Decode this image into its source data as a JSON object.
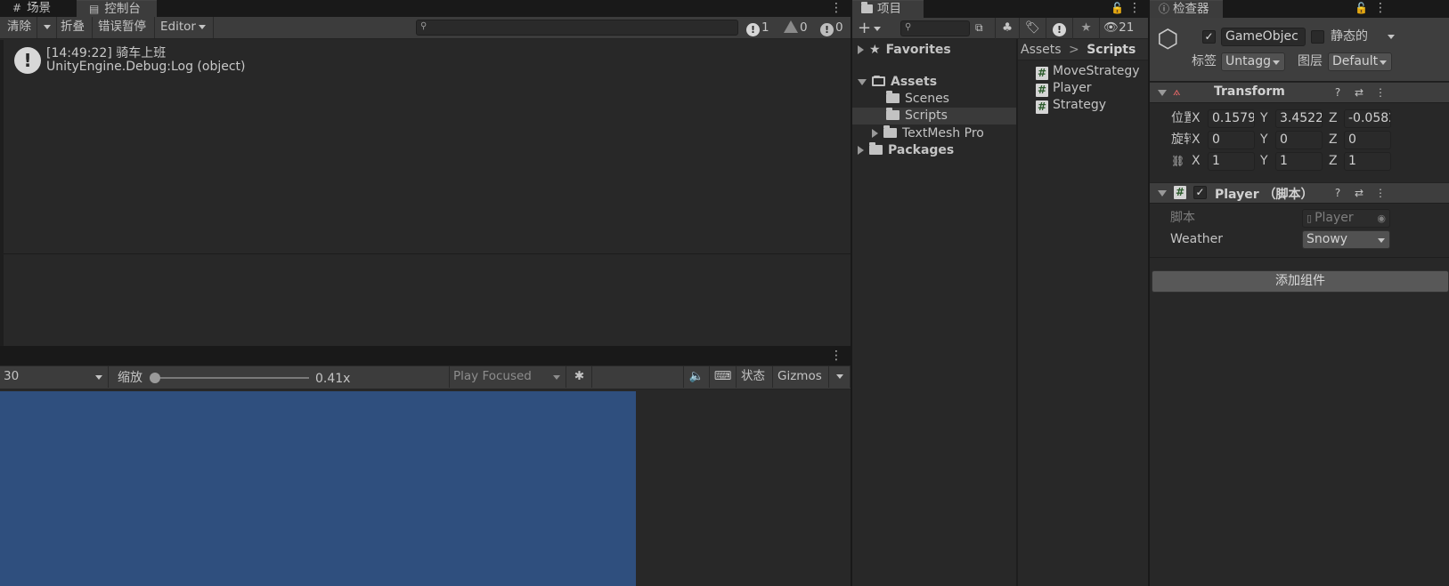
{
  "console": {
    "tabs": [
      {
        "label": "场景",
        "icon": "grid-icon"
      },
      {
        "label": "控制台",
        "icon": "console-icon"
      }
    ],
    "toolbar": {
      "clear_label": "清除",
      "collapse_label": "折叠",
      "error_pause_label": "错误暂停",
      "editor_label": "Editor",
      "search_placeholder": "",
      "log_count": "1",
      "warning_count": "0",
      "error_count": "0"
    },
    "entries": [
      {
        "time": "[14:49:22] 骑车上班",
        "detail": "UnityEngine.Debug:Log (object)"
      }
    ]
  },
  "game": {
    "resolution_value": "30",
    "scale_label": "缩放",
    "scale_value": "0.41x",
    "scale_fraction": 0.0,
    "play_mode_label": "Play Focused",
    "stats_label": "状态",
    "gizmos_label": "Gizmos",
    "view_color": "#2f4f7e"
  },
  "project": {
    "tab_label": "项目",
    "hidden_count": "21",
    "favorites_label": "Favorites",
    "tree": [
      {
        "label": "Assets",
        "level": 0,
        "bold": true,
        "expanded": true
      },
      {
        "label": "Scenes",
        "level": 1
      },
      {
        "label": "Scripts",
        "level": 1,
        "selected": true
      },
      {
        "label": "TextMesh Pro",
        "level": 1,
        "collapsed": true
      },
      {
        "label": "Packages",
        "level": 0,
        "bold": true,
        "collapsed": true
      }
    ],
    "breadcrumb": {
      "root": "Assets",
      "sep": ">",
      "current": "Scripts"
    },
    "files": [
      "MoveStrategy",
      "Player",
      "Strategy"
    ]
  },
  "inspector": {
    "tab_label": "检查器",
    "object_name": "GameObjec",
    "static_label": "静态的",
    "tag_label": "标签",
    "tag_value": "Untagg",
    "layer_label": "图层",
    "layer_value": "Default",
    "transform": {
      "title": "Transform",
      "position_label": "位置",
      "rotation_label": "旋转",
      "position": {
        "x": "0.1579",
        "y": "3.4522",
        "z": "-0.0582"
      },
      "rotation": {
        "x": "0",
        "y": "0",
        "z": "0"
      },
      "scale": {
        "x": "1",
        "y": "1",
        "z": "1"
      },
      "axis_x": "X",
      "axis_y": "Y",
      "axis_z": "Z"
    },
    "player": {
      "title": "Player （脚本）",
      "script_label": "脚本",
      "script_value": "Player",
      "weather_label": "Weather",
      "weather_value": "Snowy"
    },
    "add_component_label": "添加组件"
  }
}
